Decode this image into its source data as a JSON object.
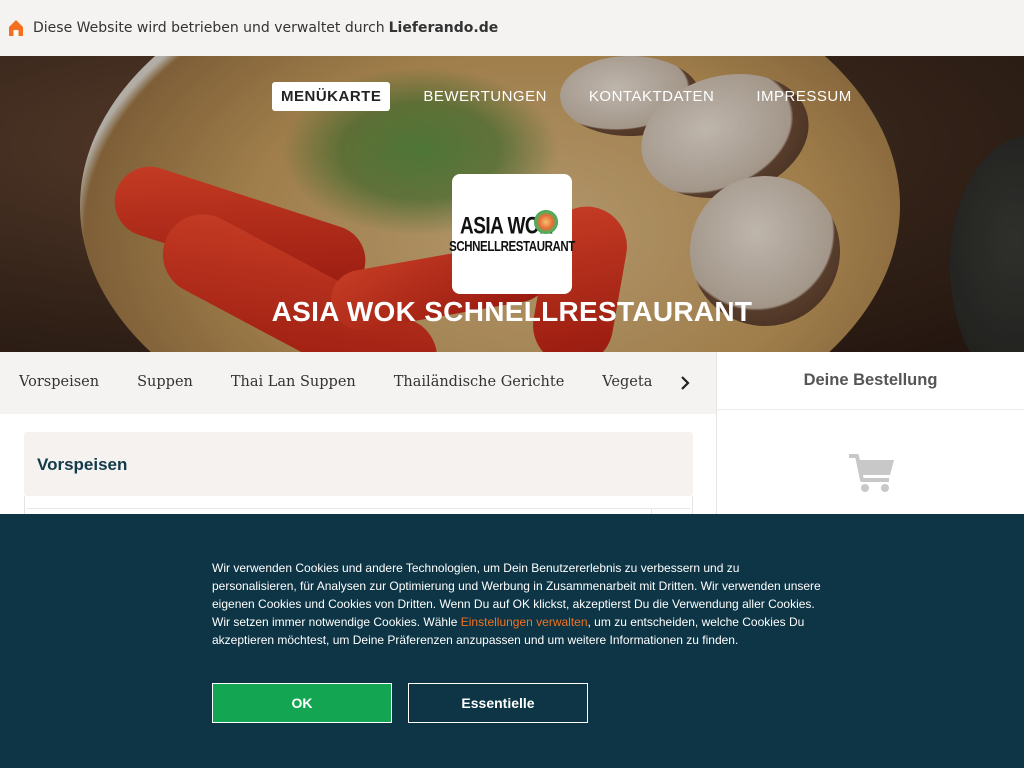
{
  "topbar": {
    "text": "Diese Website wird betrieben und verwaltet durch",
    "brand": "Lieferando.de",
    "icon": "home-icon",
    "icon_color": "#f37021"
  },
  "nav": {
    "items": [
      {
        "label": "MENÜKARTE",
        "active": true
      },
      {
        "label": "BEWERTUNGEN",
        "active": false
      },
      {
        "label": "KONTAKTDATEN",
        "active": false
      },
      {
        "label": "IMPRESSUM",
        "active": false
      }
    ]
  },
  "logo": {
    "line1": "ASIA WOK",
    "line2": "SCHNELLRESTAURANT"
  },
  "restaurant": {
    "title": "ASIA WOK SCHNELLRESTAURANT"
  },
  "categories": {
    "items": [
      "Vorspeisen",
      "Suppen",
      "Thai Lan Suppen",
      "Thailändische Gerichte",
      "Vegetarische Gerichte"
    ],
    "next_icon": "chevron-right-icon"
  },
  "menu": {
    "section_title": "Vorspeisen"
  },
  "order": {
    "title": "Deine Bestellung",
    "icon": "cart-icon"
  },
  "cookie": {
    "text_before": "Wir verwenden Cookies und andere Technologien, um Dein Benutzererlebnis zu verbessern und zu personalisieren, für Analysen zur Optimierung und Werbung in Zusammenarbeit mit Dritten. Wir verwenden unsere eigenen Cookies und Cookies von Dritten. Wenn Du auf OK klickst, akzeptierst Du die Verwendung aller Cookies. Wir setzen immer notwendige Cookies. Wähle ",
    "link": "Einstellungen verwalten",
    "text_after": ", um zu entscheiden, welche Cookies Du akzeptieren möchtest, um Deine Präferenzen anzupassen und um weitere Informationen zu finden.",
    "ok_label": "OK",
    "essential_label": "Essentielle"
  },
  "colors": {
    "accent": "#f37021",
    "cookie_bg": "#0d3545",
    "ok_green": "#13a552"
  }
}
